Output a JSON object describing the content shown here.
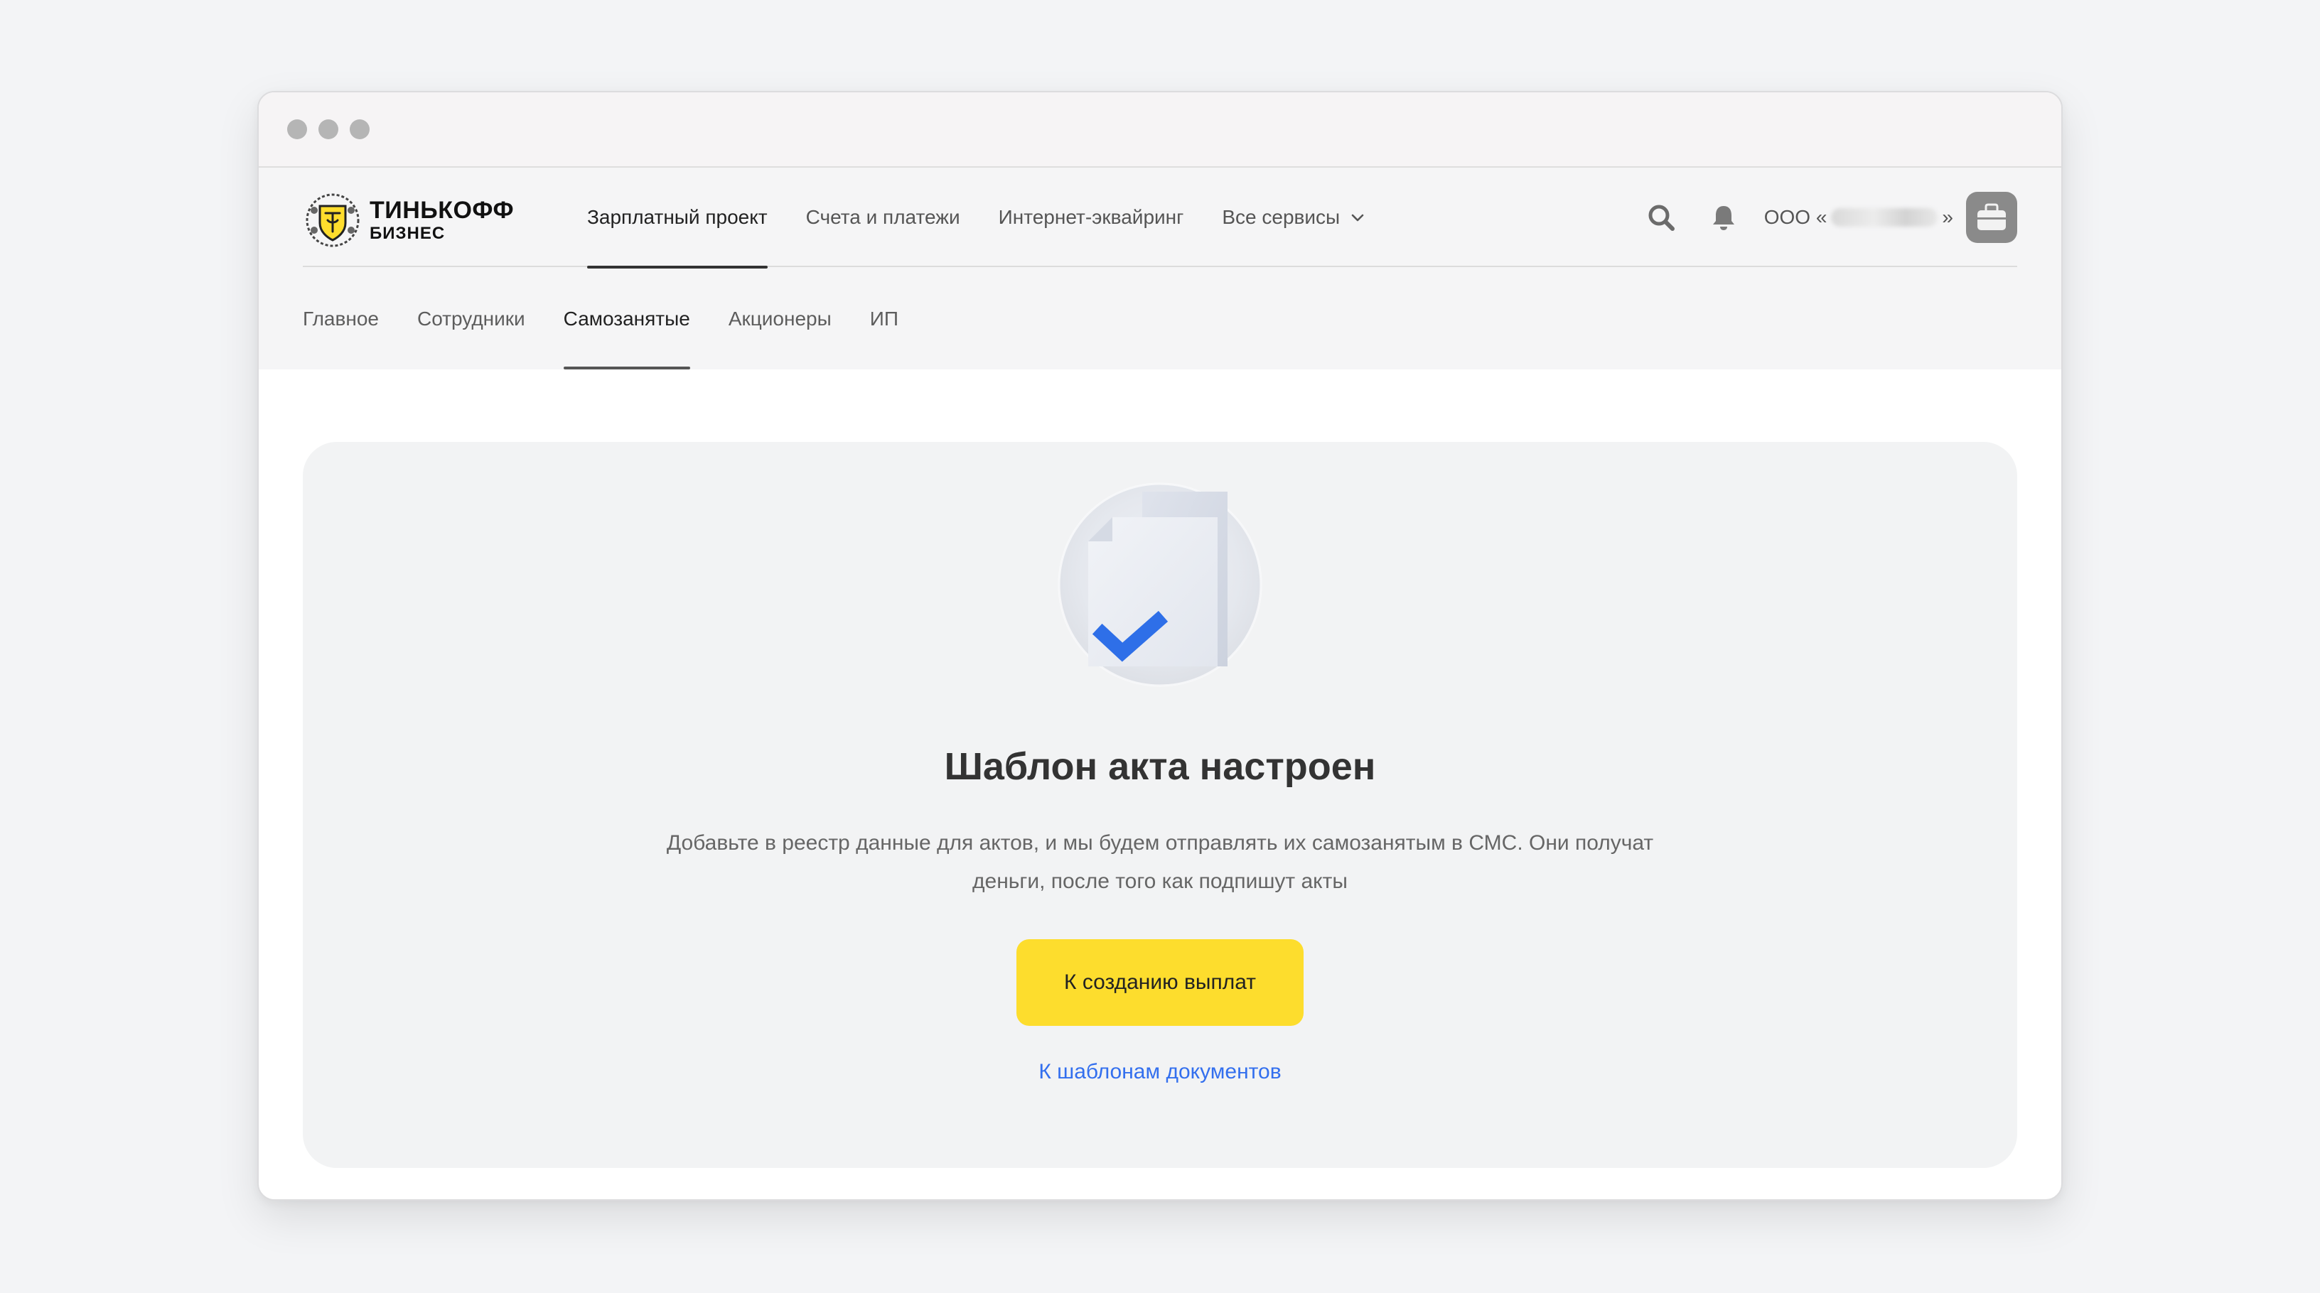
{
  "window": {
    "controls": [
      "close",
      "minimize",
      "maximize"
    ]
  },
  "brand": {
    "line1": "ТИНЬКОФФ",
    "line2": "БИЗНЕС",
    "color": "#ffdd2d"
  },
  "topnav": {
    "items": [
      {
        "label": "Зарплатный проект",
        "active": true
      },
      {
        "label": "Счета и платежи",
        "active": false
      },
      {
        "label": "Интернет-эквайринг",
        "active": false
      },
      {
        "label": "Все сервисы",
        "active": false,
        "icon": "chevron-down-icon"
      }
    ],
    "search_icon": "search-icon",
    "notifications_icon": "bell-icon",
    "org_prefix": "ООО «",
    "org_suffix": "»",
    "avatar_icon": "briefcase-icon"
  },
  "subnav": {
    "items": [
      {
        "label": "Главное",
        "active": false
      },
      {
        "label": "Сотрудники",
        "active": false
      },
      {
        "label": "Самозанятые",
        "active": true
      },
      {
        "label": "Акционеры",
        "active": false
      },
      {
        "label": "ИП",
        "active": false
      }
    ]
  },
  "main": {
    "illustration": "document-check-icon",
    "title": "Шаблон акта настроен",
    "description_line1": "Добавьте в реестр данные для актов, и мы будем отправлять их самозанятым в СМС. Они получат",
    "description_line2": "деньги, после того как подпишут акты",
    "primary_button": "К созданию выплат",
    "secondary_link": "К шаблонам документов"
  },
  "colors": {
    "accent_yellow": "#fddd2d",
    "link_blue": "#336fee",
    "check_blue": "#2e6fe8"
  }
}
